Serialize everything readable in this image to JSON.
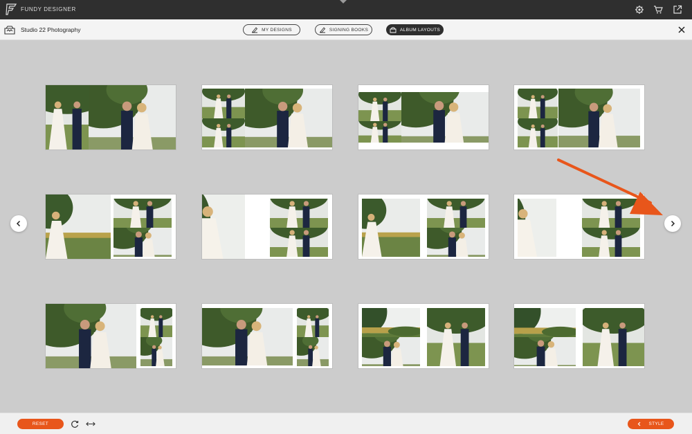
{
  "app": {
    "name": "FUNDY DESIGNER"
  },
  "header": {
    "studio_name": "Studio 22 Photography",
    "tabs": [
      {
        "label": "MY DESIGNS",
        "active": false
      },
      {
        "label": "SIGNING BOOKS",
        "active": false
      },
      {
        "label": "ALBUM LAYOUTS",
        "active": true
      }
    ]
  },
  "icons": {
    "top_right": [
      "settings-gear-icon",
      "cart-icon",
      "external-link-icon"
    ],
    "close": "close-icon",
    "prev": "chevron-left-icon",
    "next": "chevron-right-icon"
  },
  "layouts": {
    "rows": 3,
    "columns": 4,
    "count": 12
  },
  "footer": {
    "reset_label": "RESET",
    "style_label": "STYLE"
  },
  "colors": {
    "accent": "#e8561b",
    "topbar": "#2f2f2f",
    "canvas": "#cccccc"
  }
}
